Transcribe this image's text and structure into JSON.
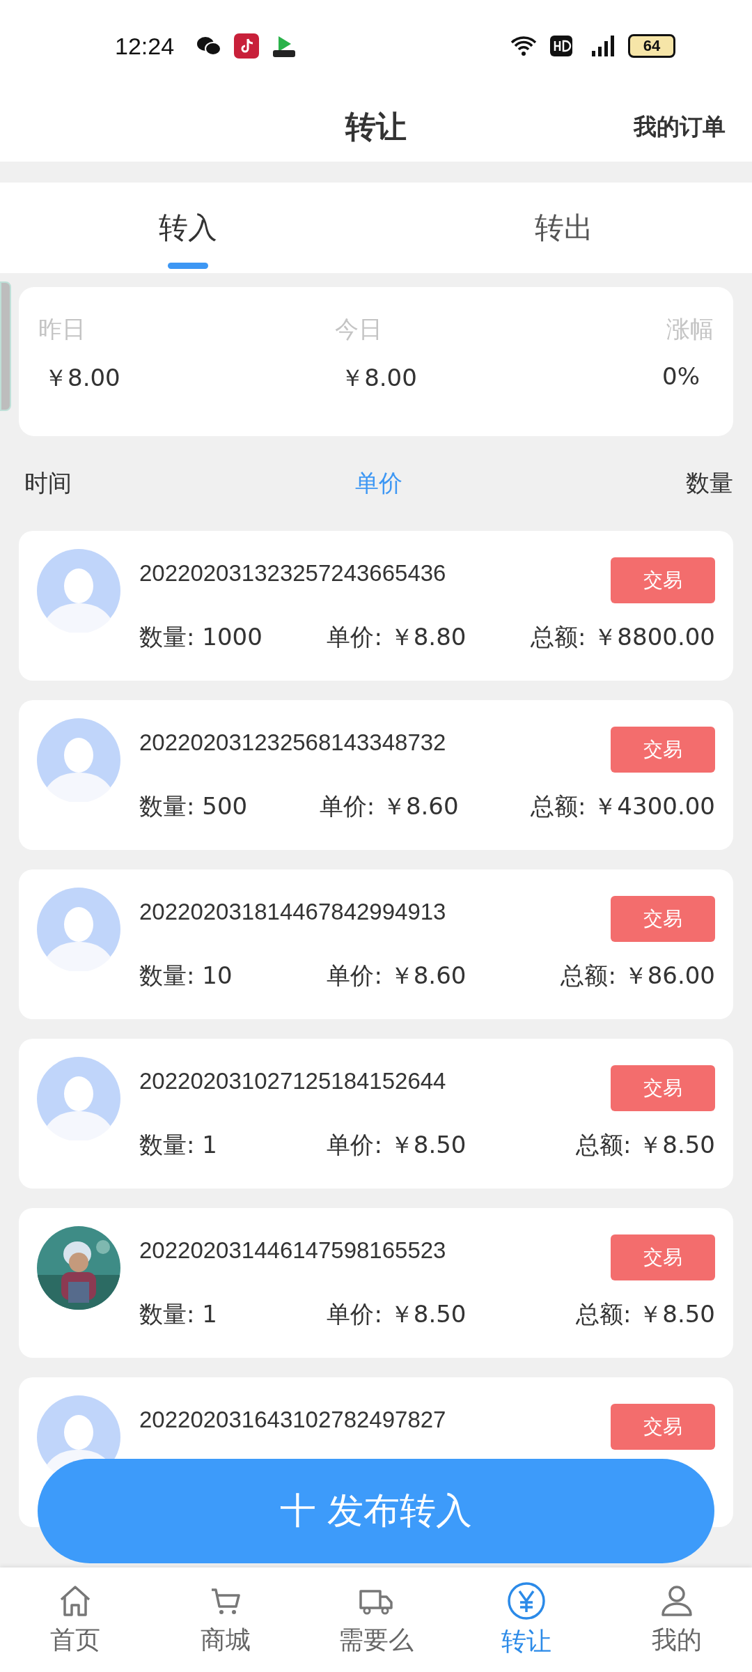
{
  "status_bar": {
    "time": "12:24",
    "battery": "64"
  },
  "header": {
    "title": "转让",
    "action": "我的订单"
  },
  "tabs": [
    {
      "label": "转入",
      "selected": true
    },
    {
      "label": "转出",
      "selected": false
    }
  ],
  "summary": [
    {
      "label": "昨日",
      "value": "￥8.00"
    },
    {
      "label": "今日",
      "value": "￥8.00"
    },
    {
      "label": "涨幅",
      "value": "0%"
    }
  ],
  "sort_bar": [
    {
      "label": "时间",
      "selected": false
    },
    {
      "label": "单价",
      "selected": true
    },
    {
      "label": "数量",
      "selected": false
    }
  ],
  "orders": [
    {
      "id": "202202031323257243665436",
      "kind": "avatar",
      "button": "交易",
      "quantity": "数量: 1000",
      "price": "单价: ￥8.80",
      "total": "总额: ￥8800.00"
    },
    {
      "id": "202202031232568143348732",
      "kind": "avatar",
      "button": "交易",
      "quantity": "数量: 500",
      "price": "单价: ￥8.60",
      "total": "总额: ￥4300.00"
    },
    {
      "id": "202202031814467842994913",
      "kind": "avatar",
      "button": "交易",
      "quantity": "数量: 10",
      "price": "单价: ￥8.60",
      "total": "总额: ￥86.00"
    },
    {
      "id": "202202031027125184152644",
      "kind": "avatar",
      "button": "交易",
      "quantity": "数量: 1",
      "price": "单价: ￥8.50",
      "total": "总额: ￥8.50"
    },
    {
      "id": "202202031446147598165523",
      "kind": "picture",
      "button": "交易",
      "quantity": "数量: 1",
      "price": "单价: ￥8.50",
      "total": "总额: ￥8.50"
    },
    {
      "id": "202202031643102782497827",
      "kind": "avatar",
      "button": "交易"
    }
  ],
  "publish_button": "十 发布转入",
  "nav": [
    {
      "label": "首页",
      "selected": false
    },
    {
      "label": "商城",
      "selected": false
    },
    {
      "label": "需要么",
      "selected": false
    },
    {
      "label": "转让",
      "selected": true
    },
    {
      "label": "我的",
      "selected": false
    }
  ]
}
